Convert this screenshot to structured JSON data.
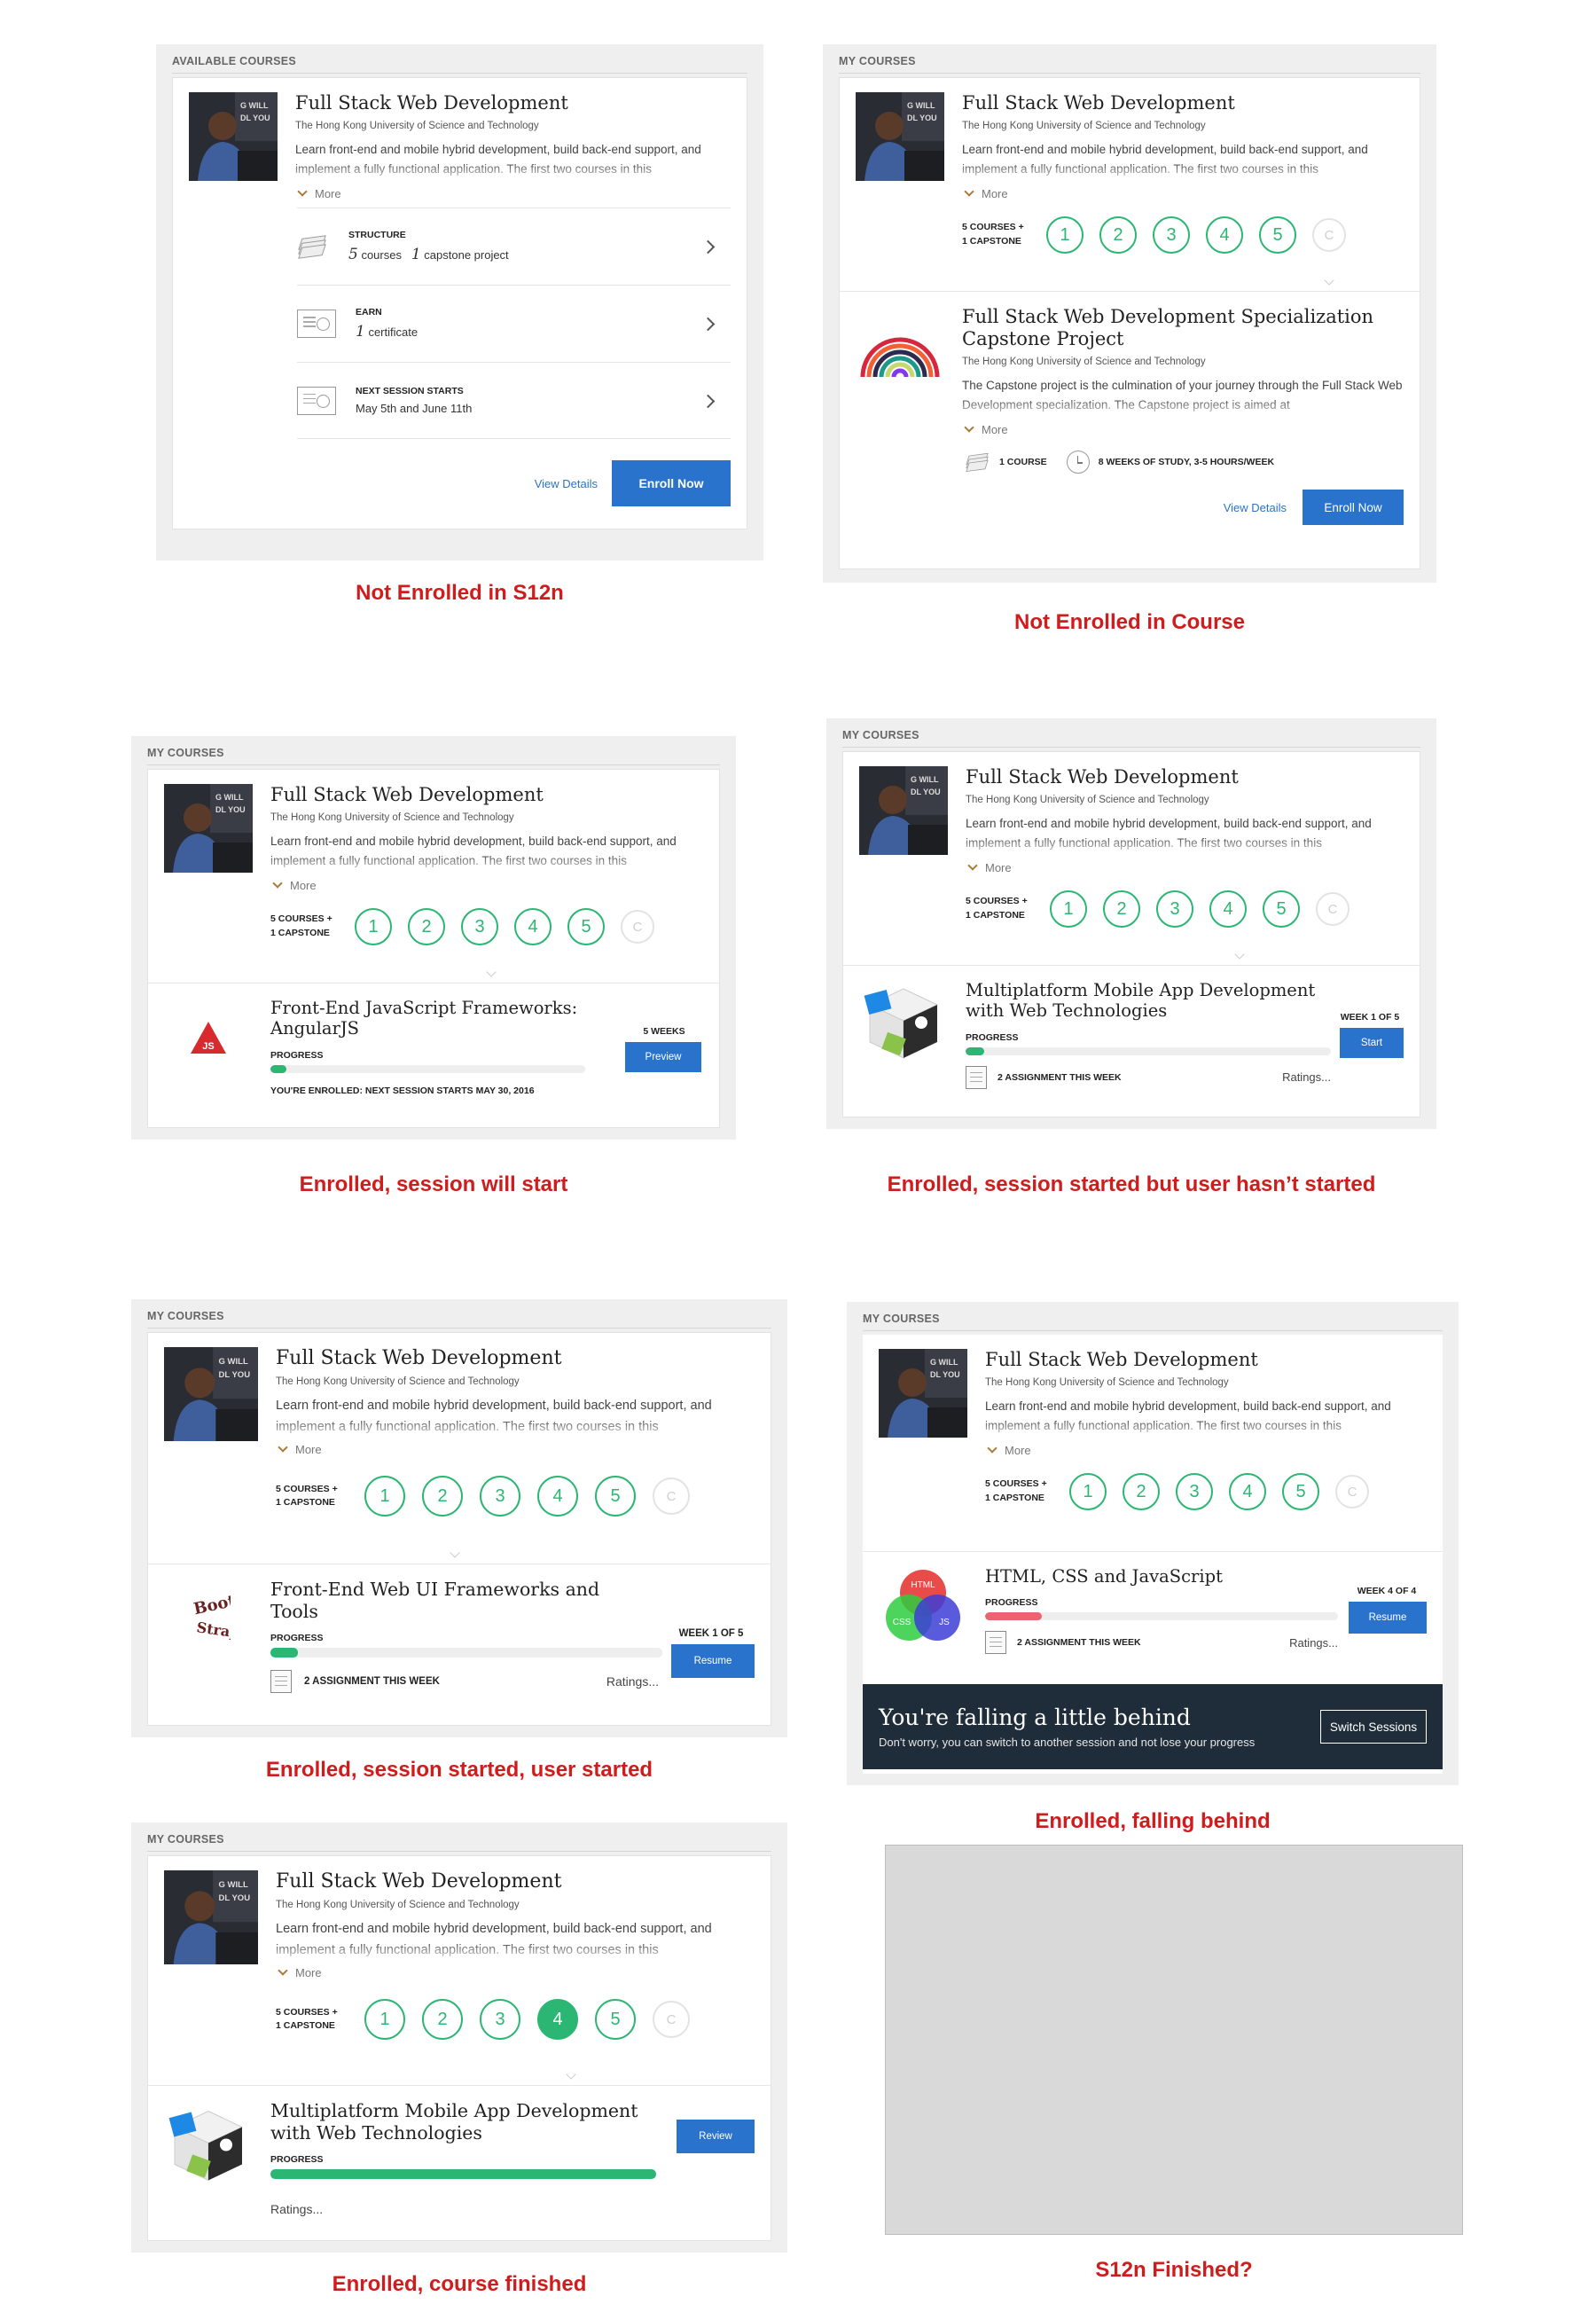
{
  "common": {
    "title": "Full Stack Web Development",
    "university": "The Hong Kong University of Science and Technology",
    "description": "Learn front-end and mobile hybrid development, build back-end support, and implement a fully functional application. The first two courses in this",
    "more": "More",
    "progress_label": [
      "5 COURSES +",
      "1 CAPSTONE"
    ],
    "progress_label_mc": "5 COURSES + 1 CAPSTONE",
    "steps": [
      "1",
      "2",
      "3",
      "4",
      "5"
    ],
    "capstone_step": "C",
    "progress": "PROGRESS",
    "ratings": "Ratings...",
    "view_details": "View Details",
    "colors": {
      "accent": "#2bb673",
      "button": "#2a73cc",
      "caption": "#cf1c1c",
      "behind": "#f06272"
    }
  },
  "panel1": {
    "header": "AVAILABLE COURSES",
    "structure_label": "STRUCTURE",
    "structure_courses_num": "5",
    "structure_courses": "courses",
    "structure_capstone_num": "1",
    "structure_capstone": "capstone project",
    "earn_label": "EARN",
    "earn_num": "1",
    "earn_text": "certificate",
    "next_label": "NEXT SESSION STARTS",
    "next_text": "May 5th and June 11th",
    "enroll": "Enroll Now",
    "caption": "Not Enrolled in S12n"
  },
  "panel2": {
    "header": "MY COURSES",
    "capstone_title": "Full Stack Web Development Specialization Capstone Project",
    "capstone_desc": "The Capstone project is the culmination of your journey through the Full Stack Web Development specialization. The Capstone project is aimed at",
    "meta_course": "1 COURSE",
    "meta_weeks": "8 WEEKS OF STUDY, 3-5 HOURS/WEEK",
    "enroll": "Enroll Now",
    "caption": "Not Enrolled in Course"
  },
  "panel3": {
    "header": "MY COURSES",
    "sub_title": "Front-End JavaScript Frameworks: AngularJS",
    "weeks": "5 WEEKS",
    "button": "Preview",
    "enrolled_note": "YOU'RE ENROLLED: NEXT SESSION STARTS MAY 30, 2016",
    "progress_value": 0.05,
    "caption": "Enrolled, session will start"
  },
  "panel4": {
    "header": "MY COURSES",
    "sub_title": "Multiplatform Mobile App Development with Web Technologies",
    "week": "WEEK 1 OF 5",
    "button": "Start",
    "assignments": "2 ASSIGNMENT THIS WEEK",
    "progress_value": 0.05,
    "caption": "Enrolled, session started but user hasn’t started"
  },
  "panel5": {
    "header": "MY COURSES",
    "sub_title": "Front-End Web UI Frameworks and Tools",
    "week": "WEEK 1 OF 5",
    "button": "Resume",
    "assignments": "2 ASSIGNMENT THIS WEEK",
    "progress_value": 0.07,
    "caption": "Enrolled, session started, user started"
  },
  "panel6": {
    "header": "MY COURSES",
    "sub_title": "HTML, CSS and JavaScript",
    "week": "WEEK 4 OF 4",
    "button": "Resume",
    "assignments": "2 ASSIGNMENT THIS WEEK",
    "progress_value": 0.16,
    "venn": [
      "HTML",
      "CSS",
      "JS"
    ],
    "behind_title": "You're falling a little behind",
    "behind_text": "Don't worry, you can switch to another session and not lose your progress",
    "switch": "Switch Sessions",
    "caption": "Enrolled, falling behind"
  },
  "panel7": {
    "header": "MY COURSES",
    "sub_title": "Multiplatform Mobile App Development with Web Technologies",
    "button": "Review",
    "progress_value": 1.0,
    "caption": "Enrolled, course finished"
  },
  "panel8": {
    "caption": "S12n Finished?"
  }
}
